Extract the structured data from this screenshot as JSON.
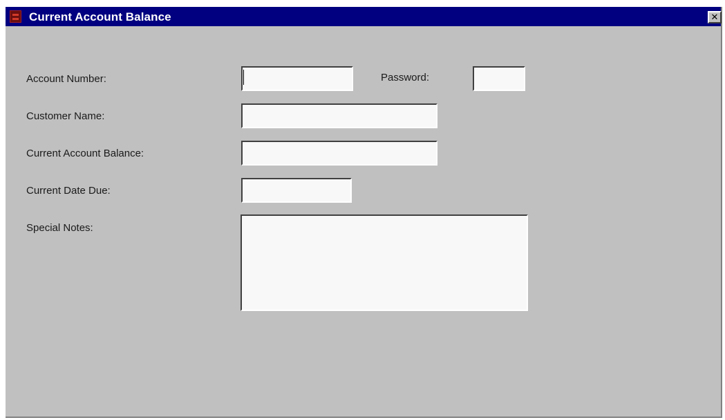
{
  "window": {
    "title": "Current Account Balance",
    "close_label": "✕"
  },
  "form": {
    "account_number": {
      "label": "Account Number:",
      "value": ""
    },
    "password": {
      "label": "Password:",
      "value": ""
    },
    "customer_name": {
      "label": "Customer Name:",
      "value": ""
    },
    "current_balance": {
      "label": "Current Account Balance:",
      "value": ""
    },
    "date_due": {
      "label": "Current Date Due:",
      "value": ""
    },
    "special_notes": {
      "label": "Special Notes:",
      "value": ""
    }
  },
  "colors": {
    "titlebar": "#000080",
    "window_bg": "#c0c0c0",
    "field_bg": "#f8f8f8"
  },
  "icons": {
    "app": "app-icon",
    "close": "close-icon"
  }
}
